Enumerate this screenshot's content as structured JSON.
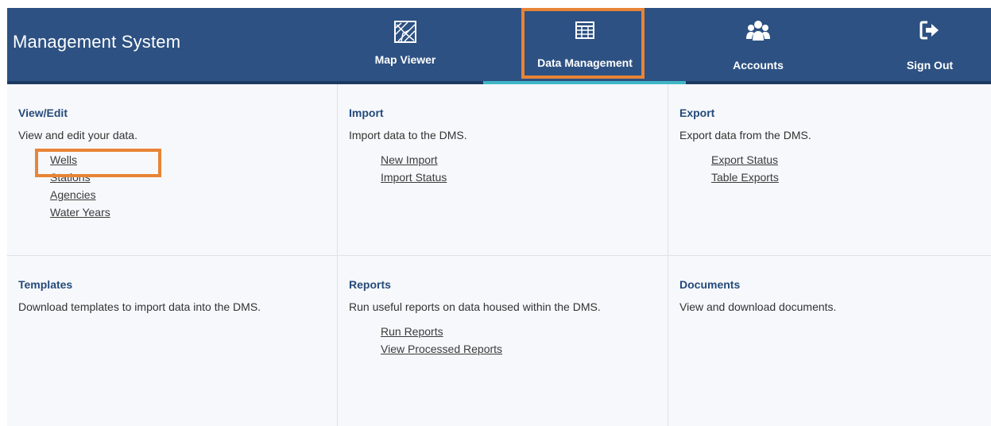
{
  "header": {
    "title": "Management System",
    "nav": [
      {
        "label": "Map Viewer",
        "icon": "map-icon"
      },
      {
        "label": "Data Management",
        "icon": "table-icon"
      },
      {
        "label": "Accounts",
        "icon": "users-icon"
      },
      {
        "label": "Sign Out",
        "icon": "sign-out-icon"
      }
    ]
  },
  "sections": {
    "view_edit": {
      "title": "View/Edit",
      "description": "View and edit your data.",
      "links": [
        "Wells",
        "Stations",
        "Agencies",
        "Water Years"
      ]
    },
    "import": {
      "title": "Import",
      "description": "Import data to the DMS.",
      "links": [
        "New Import",
        "Import Status"
      ]
    },
    "export": {
      "title": "Export",
      "description": "Export data from the DMS.",
      "links": [
        "Export Status",
        "Table Exports"
      ]
    },
    "templates": {
      "title": "Templates",
      "description": "Download templates to import data into the DMS."
    },
    "reports": {
      "title": "Reports",
      "description": "Run useful reports on data housed within the DMS.",
      "links": [
        "Run Reports",
        "View Processed Reports"
      ]
    },
    "documents": {
      "title": "Documents",
      "description": "View and download documents."
    }
  },
  "colors": {
    "header_bg": "#2d5182",
    "active_underline": "#3fb7c6",
    "highlight": "#e88436",
    "section_title": "#254a7a"
  }
}
